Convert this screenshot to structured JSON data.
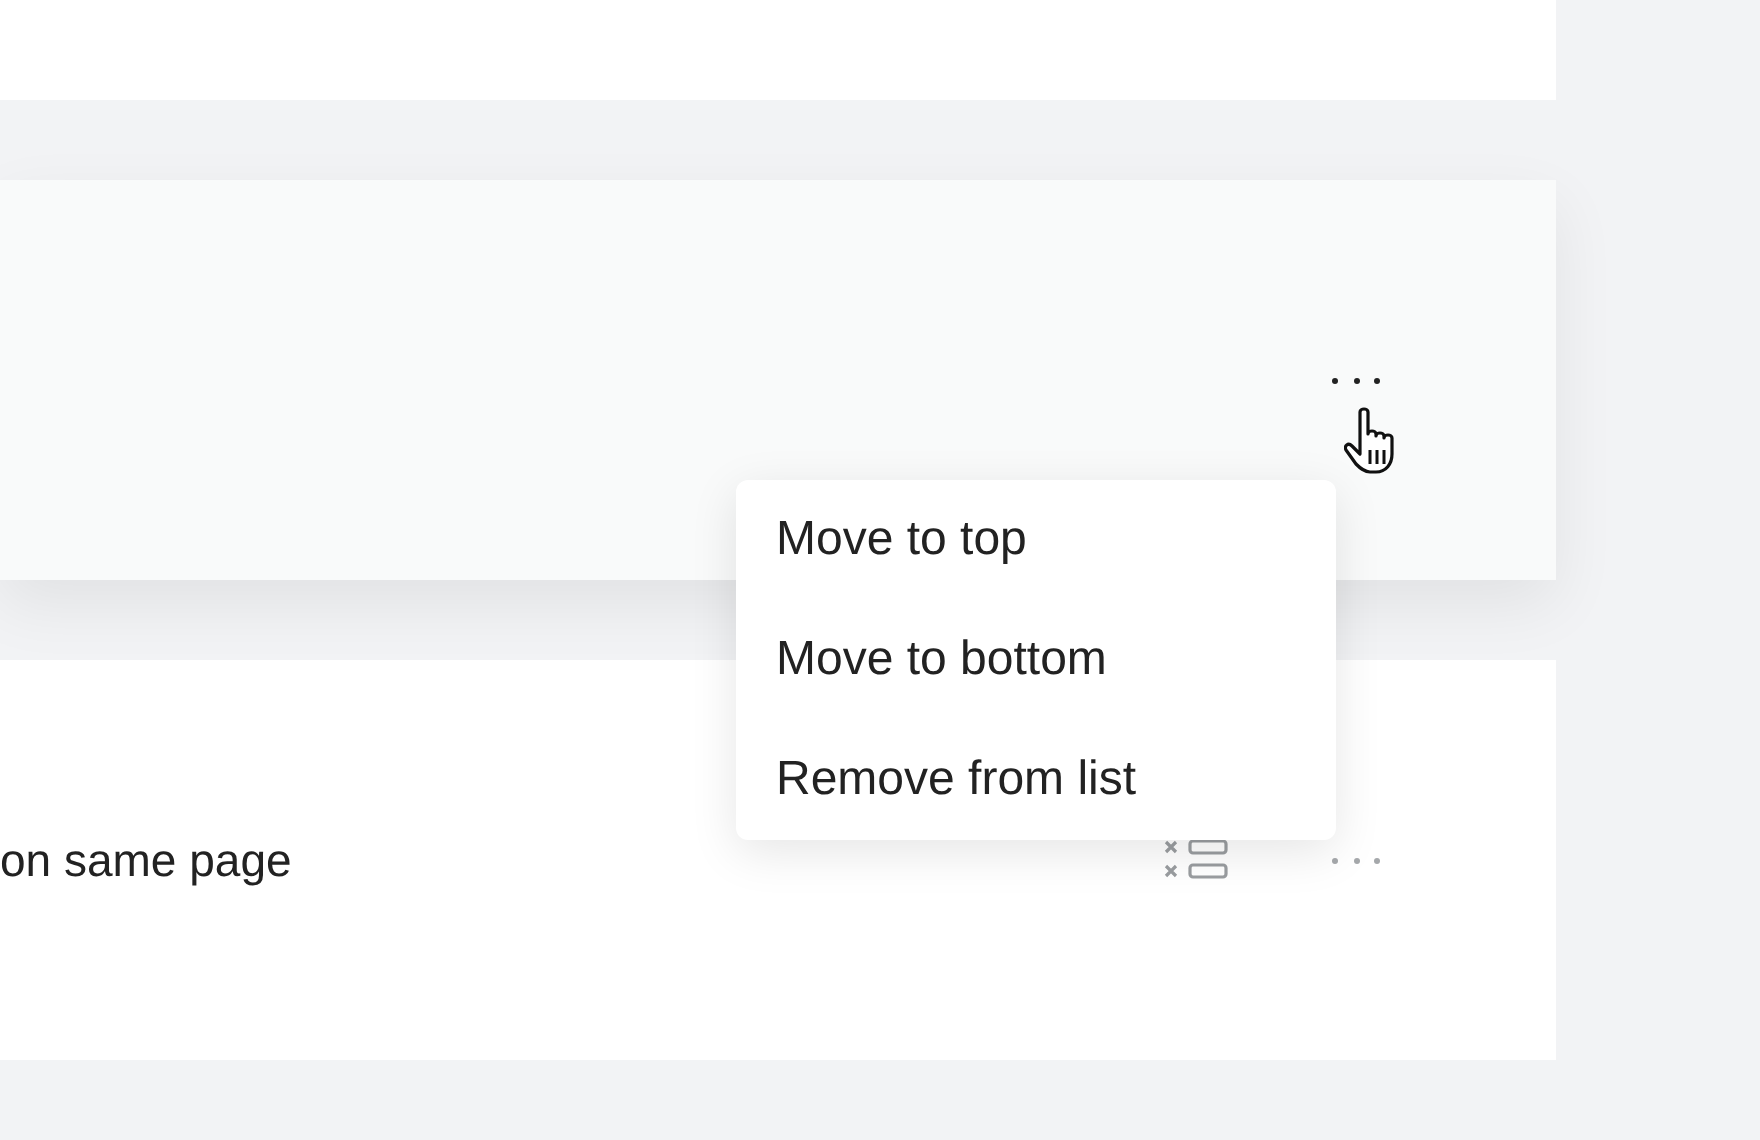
{
  "rows": [
    {
      "menu_open": true
    },
    {
      "text": "on same page",
      "menu_open": false
    }
  ],
  "menu": {
    "items": [
      "Move to top",
      "Move to bottom",
      "Remove from list"
    ]
  }
}
